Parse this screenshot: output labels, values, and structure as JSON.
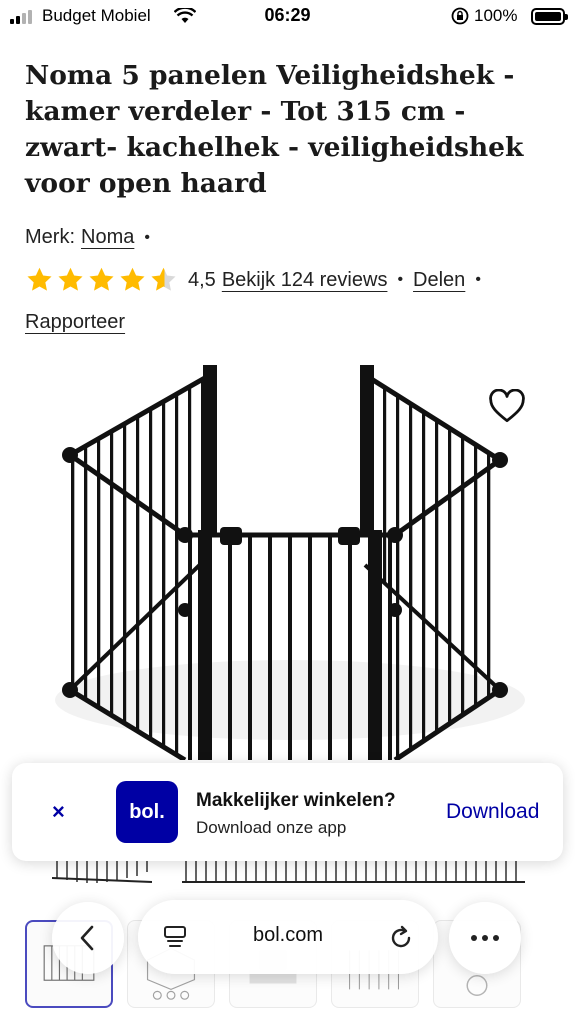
{
  "status_bar": {
    "carrier": "Budget Mobiel",
    "time": "06:29",
    "battery": "100%"
  },
  "product": {
    "title": "Noma 5 panelen Veiligheidshek - kamer verdeler - Tot 315 cm - zwart- kachelhek - veiligheidshek voor open haard",
    "brand_label": "Merk:",
    "brand": "Noma",
    "rating": {
      "stars": 4.5,
      "value": "4,5",
      "reviews_link": "Bekijk 124 reviews"
    },
    "share": "Delen",
    "report": "Rapporteer",
    "separator": "•"
  },
  "app_banner": {
    "close": "×",
    "logo": "bol.",
    "headline": "Makkelijker winkelen?",
    "subtitle": "Download onze app",
    "cta": "Download"
  },
  "browser": {
    "url": "bol.com"
  },
  "icons": {
    "back": "chevron-left-icon",
    "reader": "reader-icon",
    "reload": "reload-icon",
    "more": "more-icon",
    "favorite": "heart-icon"
  },
  "colors": {
    "brand_blue": "#0000a4",
    "star": "#ffbb00"
  }
}
